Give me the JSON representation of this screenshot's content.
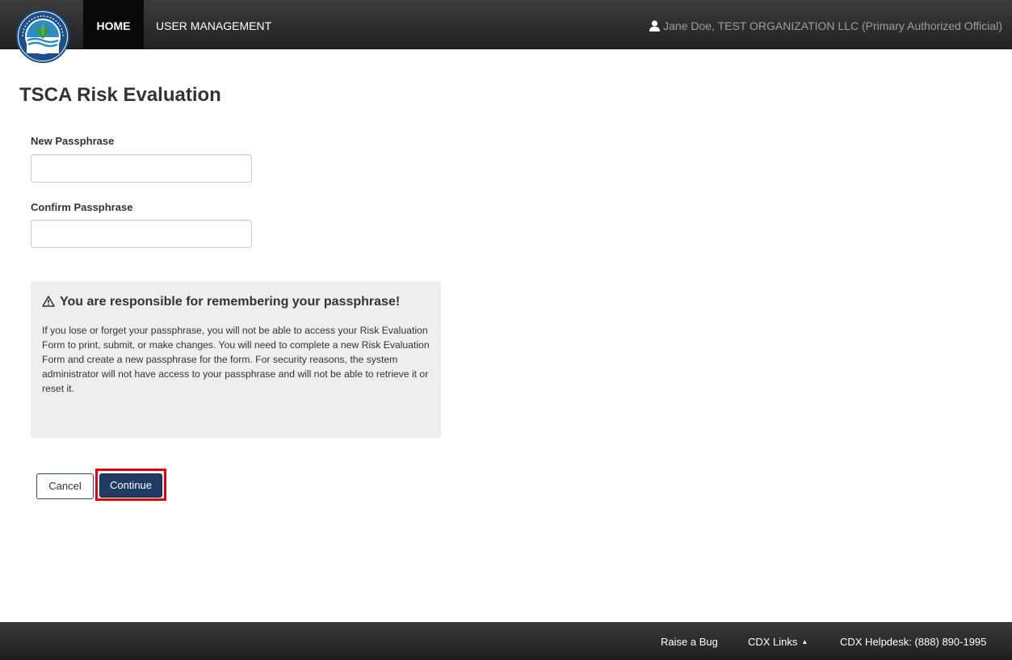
{
  "nav": {
    "home_label": "HOME",
    "user_management_label": "USER MANAGEMENT",
    "user_text": "Jane Doe, TEST ORGANIZATION LLC (Primary Authorized Official)"
  },
  "page": {
    "title": "TSCA Risk Evaluation"
  },
  "form": {
    "new_passphrase_label": "New Passphrase",
    "new_passphrase_value": "",
    "confirm_passphrase_label": "Confirm Passphrase",
    "confirm_passphrase_value": ""
  },
  "notice": {
    "heading": "You are responsible for remembering your passphrase!",
    "body": "If you lose or forget your passphrase, you will not be able to access your Risk Evaluation Form to print, submit, or make changes. You will need to complete a new Risk Evaluation Form and create a new passphrase for the form. For security reasons, the system administrator will not have access to your passphrase and will not be able to retrieve it or reset it."
  },
  "buttons": {
    "cancel_label": "Cancel",
    "continue_label": "Continue"
  },
  "footer": {
    "raise_bug_label": "Raise a Bug",
    "cdx_links_label": "CDX Links",
    "helpdesk_label": "CDX Helpdesk: (888) 890-1995"
  },
  "colors": {
    "navbar": "#222222",
    "primary_button": "#1f3a63",
    "highlight_outline": "#e5000b"
  },
  "icons": {
    "logo": "epa-seal-logo",
    "user": "user-icon",
    "warning": "warning-triangle-icon",
    "cdx_caret": "caret-up-icon"
  }
}
